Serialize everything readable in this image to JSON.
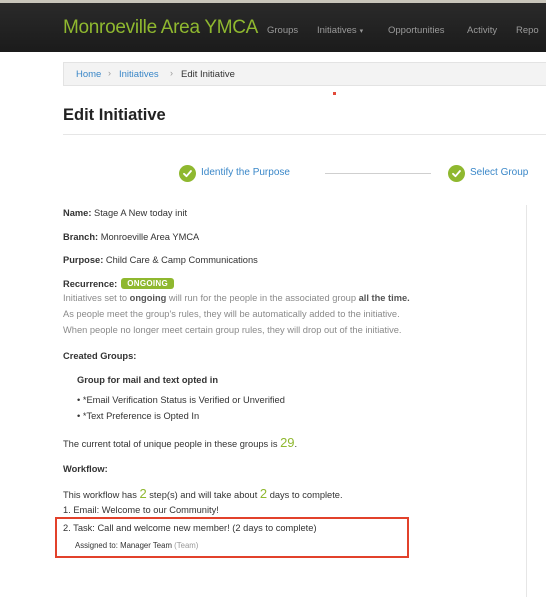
{
  "app": {
    "brand": "Monroeville Area YMCA"
  },
  "nav": {
    "groups": "Groups",
    "initiatives": "Initiatives",
    "initiatives_caret": "▾",
    "opportunities": "Opportunities",
    "activity": "Activity",
    "reports": "Repo"
  },
  "breadcrumb": {
    "home": "Home",
    "initiatives": "Initiatives",
    "current": "Edit Initiative",
    "separator": "›"
  },
  "page": {
    "title": "Edit Initiative"
  },
  "wizard": {
    "step1": "Identify the Purpose",
    "step2": "Select Group"
  },
  "details": {
    "name_label": "Name:",
    "name": "Stage A New today init",
    "branch_label": "Branch:",
    "branch": "Monroeville Area YMCA",
    "purpose_label": "Purpose:",
    "purpose": "Child Care & Camp Communications",
    "recurrence_label": "Recurrence:",
    "recurrence_badge": "ONGOING",
    "recurrence_line1_a": "Initiatives set to ",
    "recurrence_line1_b": "ongoing",
    "recurrence_line1_c": " will run for the people in the associated group ",
    "recurrence_line1_d": "all the time.",
    "recurrence_line2": "As people meet the group's rules, they will be automatically added to the initiative.",
    "recurrence_line3": "When people no longer meet certain group rules, they will drop out of the initiative."
  },
  "groups": {
    "heading": "Created Groups:",
    "group_title": "Group for mail and text opted in",
    "rules": [
      "*Email Verification Status is Verified or Unverified",
      "*Text Preference is Opted In"
    ],
    "total_text": "The current total of unique people in these groups is ",
    "total_count": "29",
    "total_suffix": "."
  },
  "workflow": {
    "heading": "Workflow:",
    "summary_a": "This workflow has ",
    "steps_count": "2",
    "summary_b": " step(s) and will take about ",
    "days_count": "2",
    "summary_c": " days to complete.",
    "step1": "1. Email: Welcome to our Community!",
    "step2": "2. Task: Call and welcome new member! (2 days to complete)",
    "assigned_label": "Assigned to: Manager Team",
    "assigned_type": "(Team)"
  },
  "colors": {
    "accent": "#8fb82f",
    "link": "#3a87c8",
    "highlight_box": "#e2412b",
    "topbar": "#1f1f1f"
  }
}
